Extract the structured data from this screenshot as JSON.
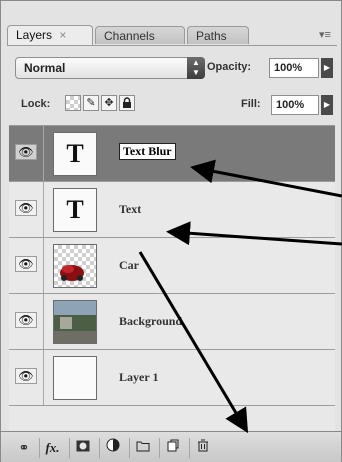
{
  "tabs": [
    {
      "label": "Layers",
      "close": "×"
    },
    {
      "label": "Channels"
    },
    {
      "label": "Paths"
    }
  ],
  "panel_menu_icon": "panel-menu-icon",
  "blend_mode": {
    "value": "Normal"
  },
  "opacity": {
    "label": "Opacity:",
    "value": "100%"
  },
  "lock": {
    "label": "Lock:"
  },
  "fill": {
    "label": "Fill:",
    "value": "100%"
  },
  "layers": [
    {
      "name": "Text Blur",
      "thumb": "T",
      "selected": true
    },
    {
      "name": "Text",
      "thumb": "T",
      "selected": false
    },
    {
      "name": "Car",
      "thumb": "",
      "selected": false
    },
    {
      "name": "Background",
      "thumb": "",
      "selected": false
    },
    {
      "name": "Layer 1",
      "thumb": "",
      "selected": false
    }
  ],
  "bottom_bar": {
    "fx_label": "fx.",
    "icons": [
      "link-layers-icon",
      "fx-icon",
      "add-mask-icon",
      "adjustment-layer-icon",
      "new-group-icon",
      "new-layer-icon",
      "trash-icon"
    ]
  }
}
